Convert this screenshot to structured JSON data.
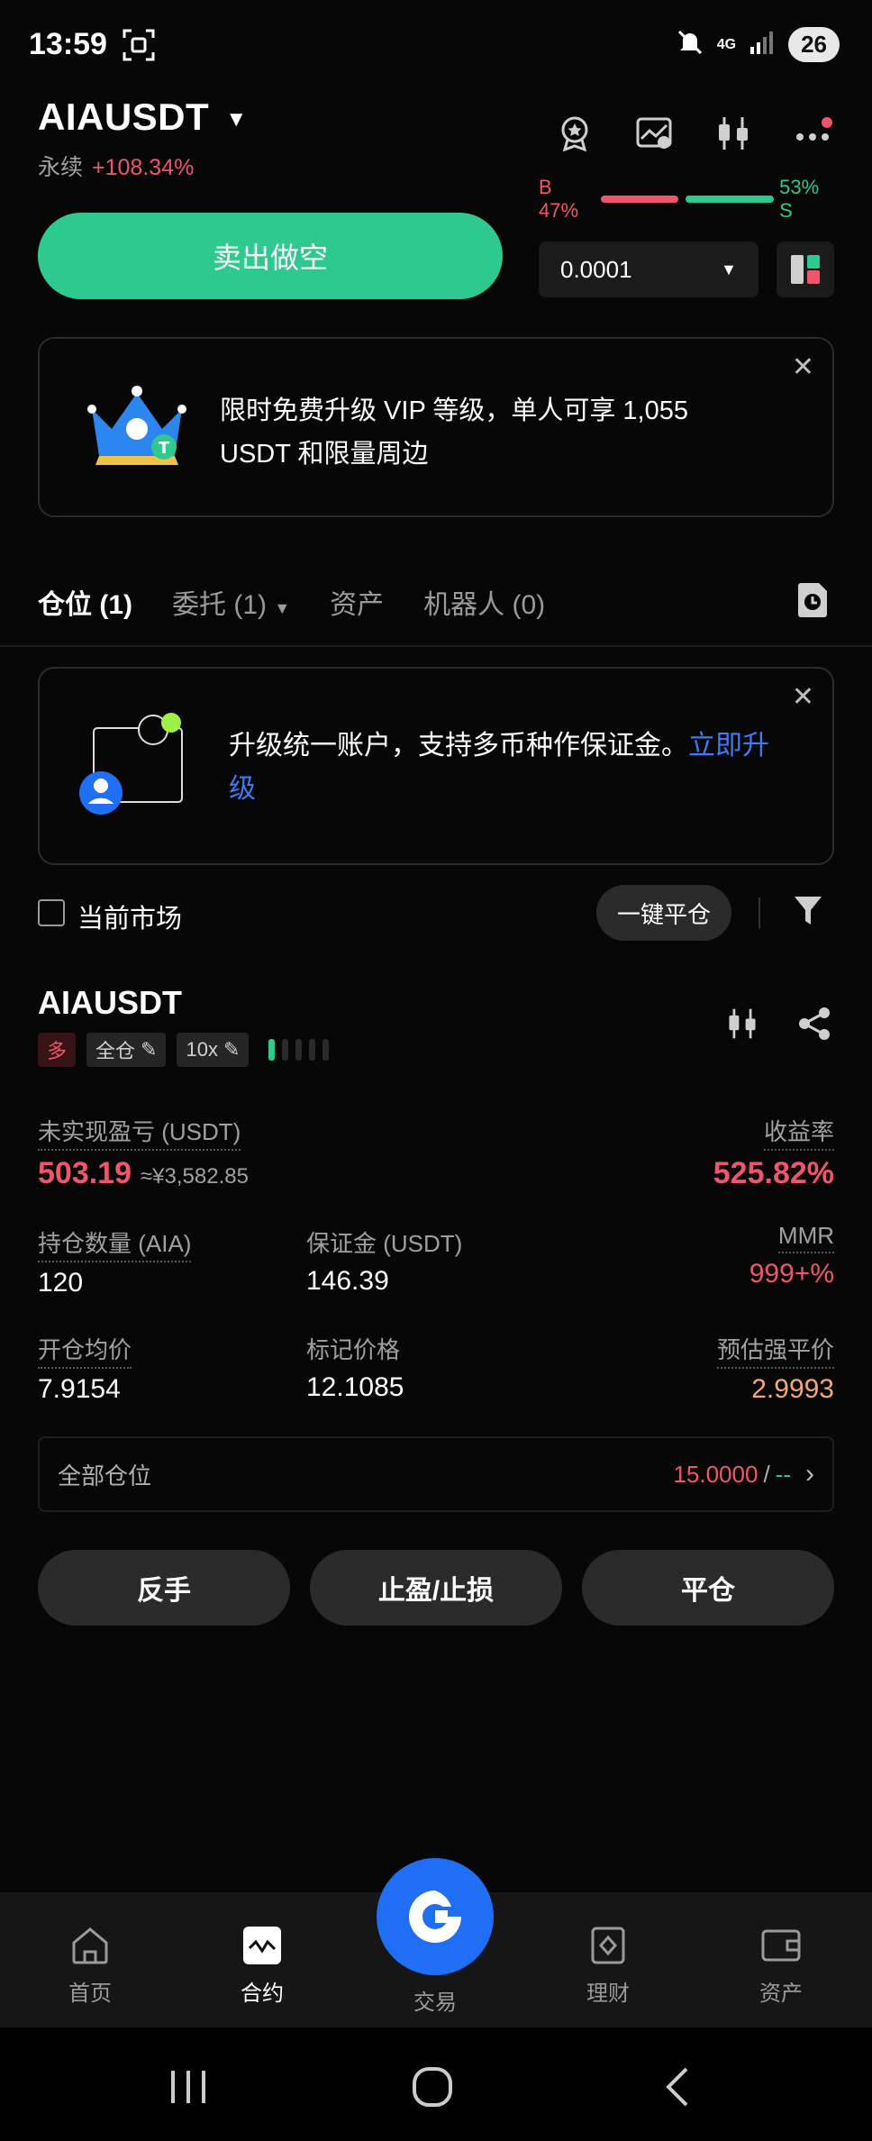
{
  "status_bar": {
    "time": "13:59",
    "battery": "26",
    "network": "4G"
  },
  "header": {
    "pair": "AIAUSDT",
    "contract_type": "永续",
    "change": "+108.34%",
    "buy_ratio": "B 47%",
    "sell_ratio": "53% S",
    "buy_fraction": 0.47
  },
  "order": {
    "sell_label": "卖出做空",
    "quantity": "0.0001"
  },
  "promo": {
    "text": "限时免费升级 VIP 等级，单人可享 1,055 USDT 和限量周边"
  },
  "tabs": [
    {
      "label": "仓位 (1)"
    },
    {
      "label": "委托 (1)"
    },
    {
      "label": "资产"
    },
    {
      "label": "机器人 (0)"
    }
  ],
  "account_card": {
    "text": "升级统一账户，支持多币种作保证金。",
    "link": "立即升级"
  },
  "filter": {
    "current_market_label": "当前市场",
    "close_all_label": "一键平仓"
  },
  "position": {
    "symbol": "AIAUSDT",
    "side_tag": "多",
    "margin_mode": "全仓",
    "leverage": "10x",
    "leverage_level_fraction": 0.2,
    "unrealized_pnl_label": "未实现盈亏 (USDT)",
    "unrealized_pnl": "503.19",
    "unrealized_pnl_cny": "≈¥3,582.85",
    "roe_label": "收益率",
    "roe": "525.82%",
    "size_label": "持仓数量 (AIA)",
    "size": "120",
    "margin_label": "保证金 (USDT)",
    "margin": "146.39",
    "mmr_label": "MMR",
    "mmr": "999+%",
    "entry_label": "开仓均价",
    "entry": "7.9154",
    "mark_label": "标记价格",
    "mark": "12.1085",
    "liq_label": "预估强平价",
    "liq": "2.9993",
    "all_positions_label": "全部仓位",
    "all_positions_value": "15.0000",
    "all_positions_sep": "/",
    "all_positions_dash": "--"
  },
  "actions": {
    "reverse": "反手",
    "tpsl": "止盈/止损",
    "close": "平仓"
  },
  "bottom_nav": [
    {
      "label": "首页",
      "icon": "home-icon"
    },
    {
      "label": "合约",
      "icon": "futures-icon"
    },
    {
      "label": "交易",
      "icon": "trade-icon"
    },
    {
      "label": "理财",
      "icon": "earn-icon"
    },
    {
      "label": "资产",
      "icon": "wallet-icon"
    }
  ],
  "colors": {
    "green": "#2ec98e",
    "red": "#f0556c",
    "blue": "#1f6ef5",
    "orange": "#f5a875"
  }
}
